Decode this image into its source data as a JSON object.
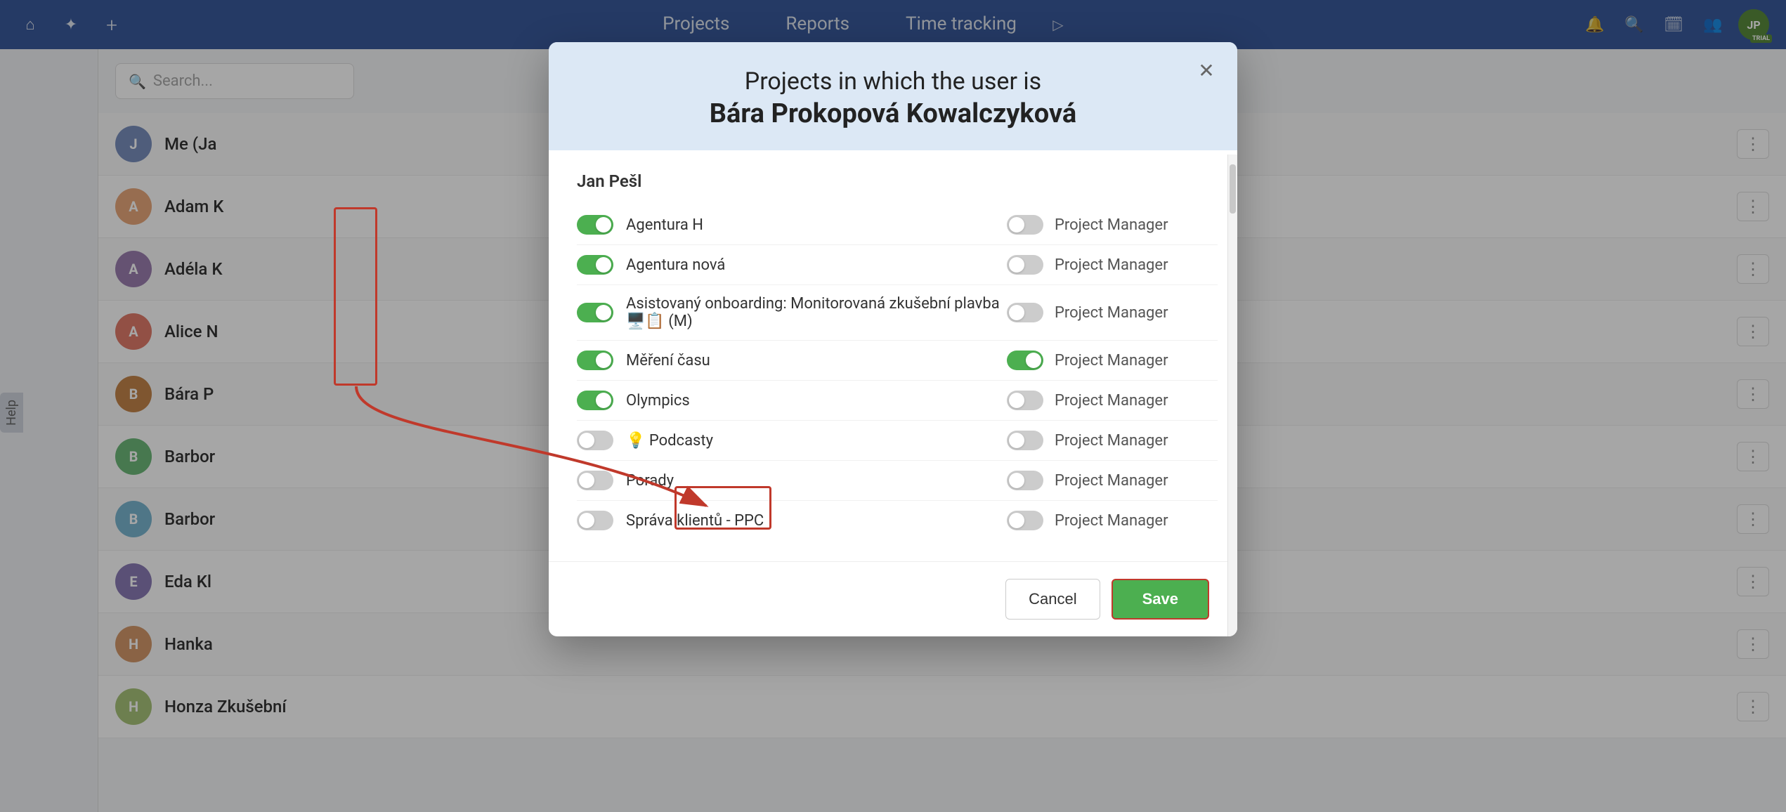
{
  "nav": {
    "tabs": [
      {
        "label": "Projects",
        "id": "projects"
      },
      {
        "label": "Reports",
        "id": "reports"
      },
      {
        "label": "Time tracking",
        "id": "time-tracking"
      }
    ],
    "icons": {
      "home": "⌂",
      "settings": "✦",
      "add": "+",
      "play": "▷",
      "bell": "🔔",
      "search": "🔍",
      "calendar": "📅",
      "people": "👥"
    },
    "avatar_text": "JP",
    "trial_label": "TRIAL"
  },
  "sidebar": {
    "help_label": "Help"
  },
  "search": {
    "placeholder": "Search..."
  },
  "users": [
    {
      "name": "Me (Ja",
      "color": "#7a8fbd",
      "initial": "J"
    },
    {
      "name": "Adam K",
      "color": "#e8a87c",
      "initial": "A"
    },
    {
      "name": "Adéla K",
      "color": "#9b7fb0",
      "initial": "A"
    },
    {
      "name": "Alice N",
      "color": "#e07b6a",
      "initial": "A"
    },
    {
      "name": "Bára P",
      "color": "#c4844a",
      "initial": "B"
    },
    {
      "name": "Barbor",
      "color": "#6db87a",
      "initial": "B"
    },
    {
      "name": "Barbor",
      "color": "#7ab5d0",
      "initial": "B"
    },
    {
      "name": "Eda Kl",
      "color": "#8b7bb5",
      "initial": "E"
    },
    {
      "name": "Hanka",
      "color": "#d4996a",
      "initial": "H"
    },
    {
      "name": "Honza Zkušební",
      "color": "#a8c47a",
      "initial": "H"
    }
  ],
  "modal": {
    "title_line1": "Projects in which the user is",
    "title_line2": "Bára Prokopová Kowalczyková",
    "section_owner": "Jan Pešl",
    "projects": [
      {
        "name": "Agentura H",
        "active": true,
        "pm_active": false,
        "pm_label": "Project Manager",
        "has_icon": false
      },
      {
        "name": "Agentura nová",
        "active": true,
        "pm_active": false,
        "pm_label": "Project Manager",
        "has_icon": false
      },
      {
        "name": "Asistovaný onboarding: Monitorovaná zkušební plavba 🖥️📋 (M)",
        "active": true,
        "pm_active": false,
        "pm_label": "Project Manager",
        "has_icon": false
      },
      {
        "name": "Měření času",
        "active": true,
        "pm_active": true,
        "pm_label": "Project Manager",
        "has_icon": false
      },
      {
        "name": "Olympics",
        "active": true,
        "pm_active": false,
        "pm_label": "Project Manager",
        "has_icon": false
      },
      {
        "name": "Podcasty",
        "active": false,
        "pm_active": false,
        "pm_label": "Project Manager",
        "has_icon": true,
        "icon": "💡"
      },
      {
        "name": "Porady",
        "active": false,
        "pm_active": false,
        "pm_label": "Project Manager",
        "has_icon": false
      },
      {
        "name": "Správa klientů - PPC",
        "active": false,
        "pm_active": false,
        "pm_label": "Project Manager",
        "has_icon": false
      }
    ],
    "cancel_label": "Cancel",
    "save_label": "Save"
  }
}
